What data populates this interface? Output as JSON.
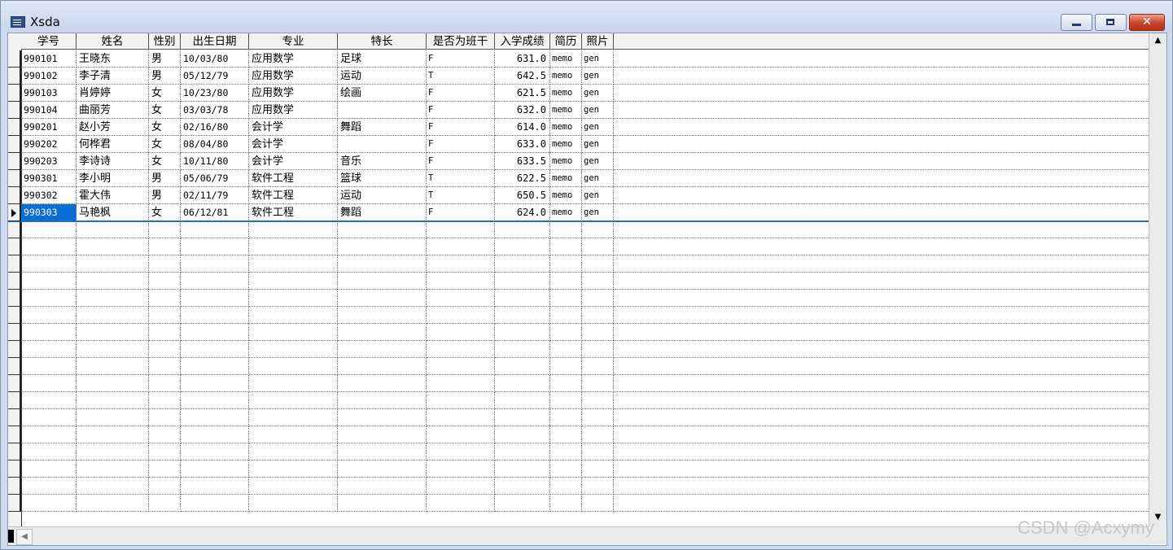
{
  "window": {
    "title": "Xsda",
    "minimize_icon": "minimize-icon",
    "maximize_icon": "maximize-icon",
    "close_icon": "close-icon",
    "close_glyph": "✕"
  },
  "table": {
    "columns": [
      "学号",
      "姓名",
      "性别",
      "出生日期",
      "专业",
      "特长",
      "是否为班干",
      "入学成绩",
      "简历",
      "照片"
    ],
    "rows": [
      [
        "990101",
        "王晓东",
        "男",
        "10/03/80",
        "应用数学",
        "足球",
        "F",
        "631.0",
        "memo",
        "gen"
      ],
      [
        "990102",
        "李子清",
        "男",
        "05/12/79",
        "应用数学",
        "运动",
        "T",
        "642.5",
        "memo",
        "gen"
      ],
      [
        "990103",
        "肖婷婷",
        "女",
        "10/23/80",
        "应用数学",
        "绘画",
        "F",
        "621.5",
        "memo",
        "gen"
      ],
      [
        "990104",
        "曲丽芳",
        "女",
        "03/03/78",
        "应用数学",
        "",
        "F",
        "632.0",
        "memo",
        "gen"
      ],
      [
        "990201",
        "赵小芳",
        "女",
        "02/16/80",
        "会计学",
        "舞蹈",
        "F",
        "614.0",
        "memo",
        "gen"
      ],
      [
        "990202",
        "何桦君",
        "女",
        "08/04/80",
        "会计学",
        "",
        "F",
        "633.0",
        "memo",
        "gen"
      ],
      [
        "990203",
        "李诗诗",
        "女",
        "10/11/80",
        "会计学",
        "音乐",
        "F",
        "633.5",
        "memo",
        "gen"
      ],
      [
        "990301",
        "李小明",
        "男",
        "05/06/79",
        "软件工程",
        "篮球",
        "T",
        "622.5",
        "memo",
        "gen"
      ],
      [
        "990302",
        "霍大伟",
        "男",
        "02/11/79",
        "软件工程",
        "运动",
        "T",
        "650.5",
        "memo",
        "gen"
      ],
      [
        "990303",
        "马艳枫",
        "女",
        "06/12/81",
        "软件工程",
        "舞蹈",
        "F",
        "624.0",
        "memo",
        "gen"
      ]
    ],
    "current_row_index": 9,
    "empty_rows": 17
  },
  "scroll": {
    "up_glyph": "▲",
    "down_glyph": "▼",
    "left_glyph": "◀"
  },
  "watermark": "CSDN @Acxymy",
  "colors": {
    "selection": "#0a6cd6",
    "close_button": "#c7432a",
    "title_gradient_top": "#dfe8f5"
  }
}
